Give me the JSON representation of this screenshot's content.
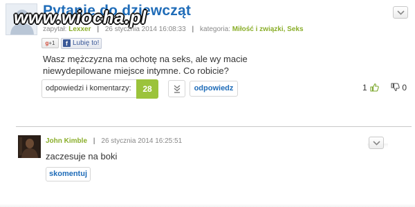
{
  "watermark": "www.wiocha.pl",
  "question": {
    "title": "Pytanie do dziewcząt",
    "meta": {
      "asked_label": "zapytał:",
      "author": "Lexxer",
      "date": "26 stycznia 2014 16:08:33",
      "category_label": "kategoria:",
      "category": "Miłość i związki, Seks"
    },
    "social": {
      "gplus_label": "+1",
      "fb_like_label": "Lubię to!"
    },
    "body": "Wasz mężczyzna ma ochotę na seks, ale wy macie niewydepilowane miejsce intymne. Co robicie?",
    "actions": {
      "answers_label": "odpowiedzi i komentarzy:",
      "answers_count": "28",
      "reply_label": "odpowiedz"
    },
    "votes": {
      "up": "1",
      "down": "0"
    }
  },
  "comment": {
    "author": "John Kimble",
    "date": "26 stycznia 2014 16:25:51",
    "body": "zaczesuje na boki",
    "comment_button": "skomentuj"
  },
  "colors": {
    "title_blue": "#1f6cb8",
    "accent_green": "#9bc33b",
    "author_green": "#8aae2a"
  }
}
